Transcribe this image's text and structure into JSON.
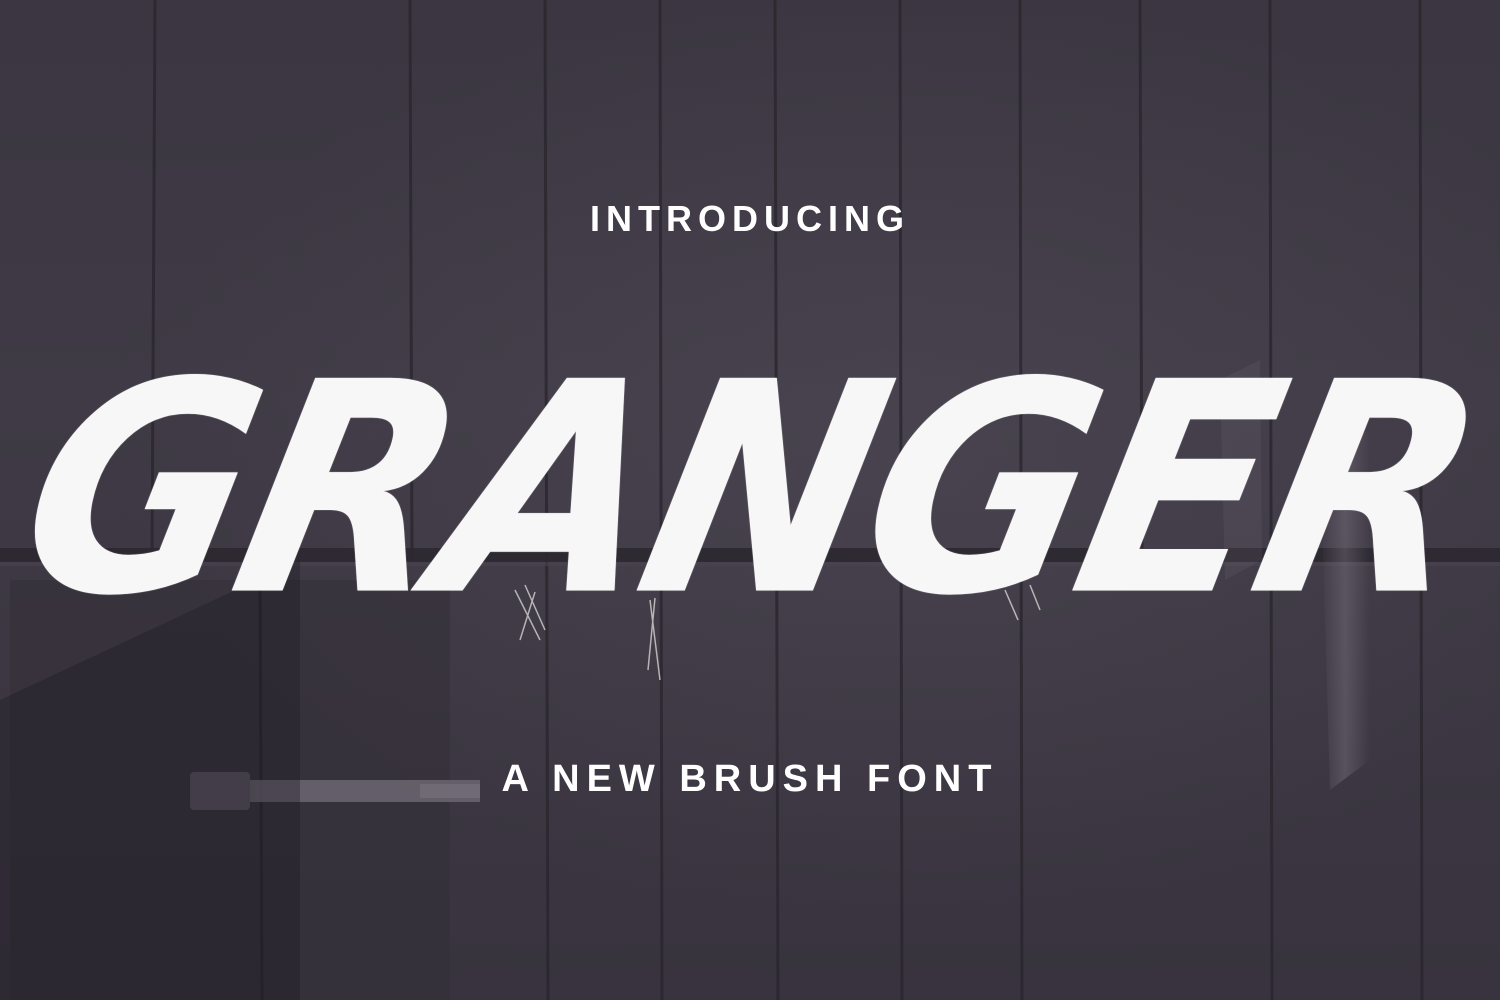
{
  "intro_text": "INTRODUCING",
  "brand_name": "GRANGER",
  "tagline": "A NEW BRUSH FONT",
  "colors": {
    "background": "#3a3540",
    "text": "#ffffff"
  }
}
